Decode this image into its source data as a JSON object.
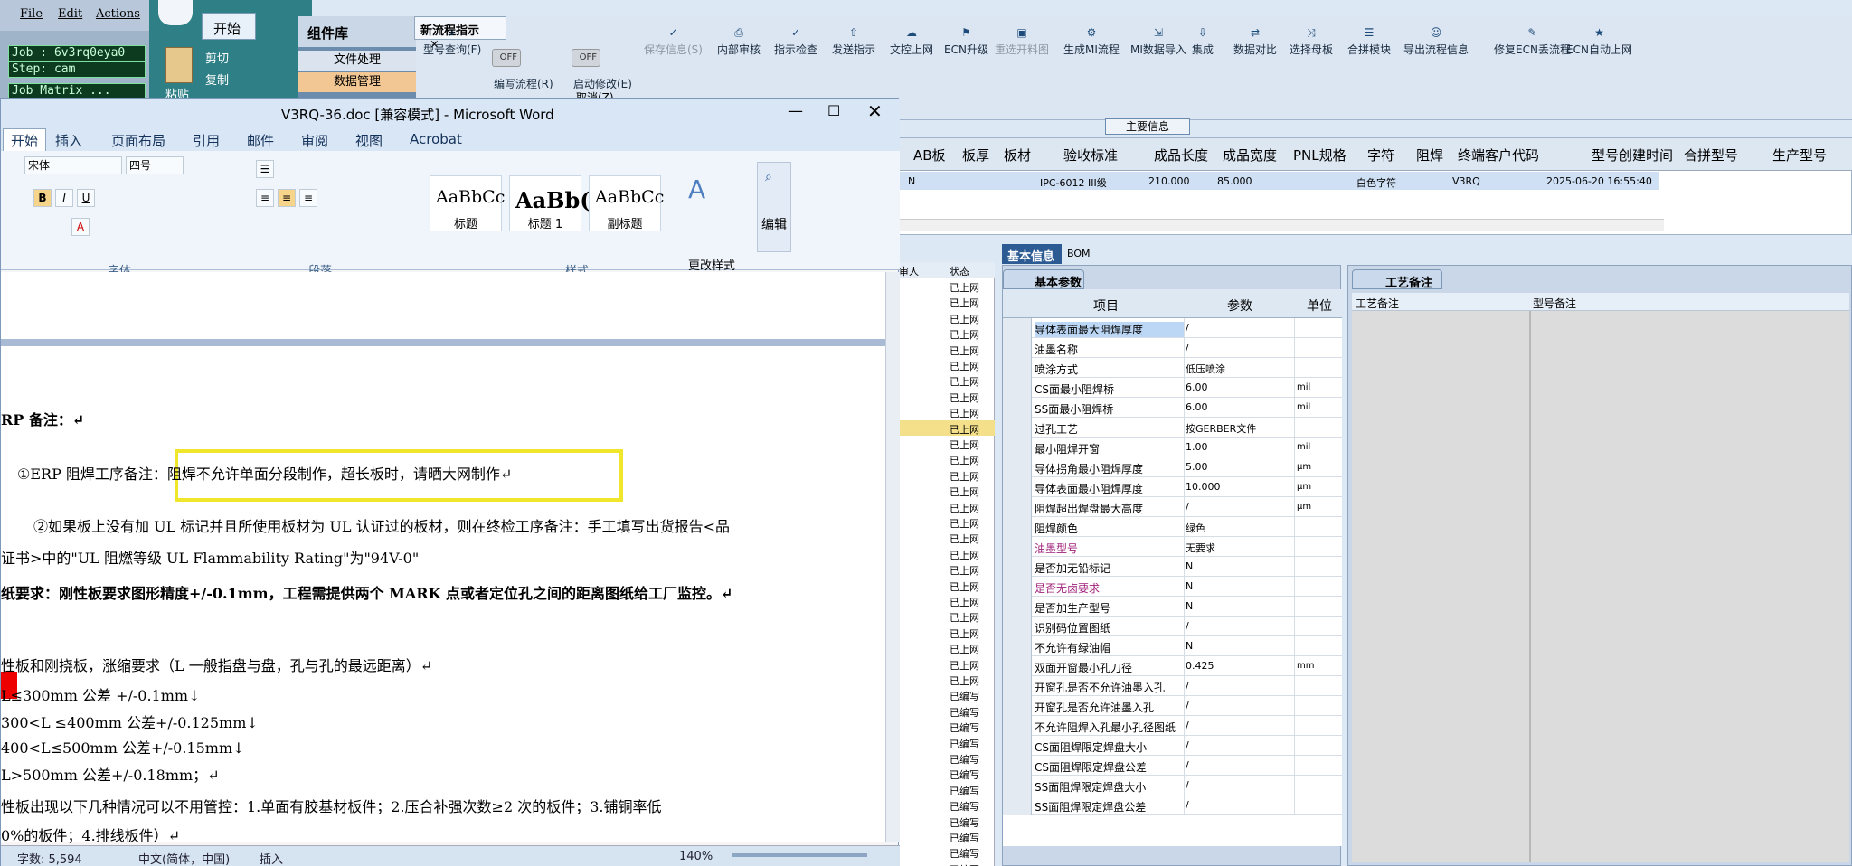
{
  "erp": {
    "menu": {
      "file": "File",
      "edit": "Edit",
      "actions": "Actions"
    },
    "job_label": "Job : 6v3rq0eya0",
    "step_label": "Step: cam",
    "matrix_label": "Job Matrix ...",
    "start_tab": "开始",
    "lib_header": "组件库",
    "lib_btn1": "文件处理",
    "lib_btn2": "数据管理",
    "doc_tab": "新流程指示",
    "cut_label": "剪切",
    "copy_label": "复制",
    "paste_label": "粘贴",
    "toolbar": [
      {
        "label": "型号查询(F)",
        "icon": "search-icon"
      },
      {
        "label": "编写流程(R)",
        "icon": "toggle"
      },
      {
        "label": "启动修改(E)",
        "icon": "toggle"
      },
      {
        "label": "保存信息(S)",
        "icon": "check-icon",
        "disabled": true
      },
      {
        "label": "内部审核",
        "icon": "print-icon"
      },
      {
        "label": "指示检查",
        "icon": "check-icon"
      },
      {
        "label": "发送指示",
        "icon": "upload-icon"
      },
      {
        "label": "文控上网",
        "icon": "cloud-icon"
      },
      {
        "label": "ECN升级",
        "icon": "ab-icon"
      },
      {
        "label": "重选开料图",
        "icon": "image-icon",
        "disabled": true
      },
      {
        "label": "生成MI流程",
        "icon": "gear-icon"
      },
      {
        "label": "MI数据导入",
        "icon": "import-icon"
      },
      {
        "label": "集成",
        "icon": "download-icon"
      },
      {
        "label": "数据对比",
        "icon": "compare-icon"
      },
      {
        "label": "选择母板",
        "icon": "shuffle-icon"
      },
      {
        "label": "合拼模块",
        "icon": "list-icon"
      },
      {
        "label": "导出流程信息",
        "icon": "smile-icon"
      },
      {
        "label": "修复ECN丢流程",
        "icon": "wrench-icon"
      },
      {
        "label": "ECN自动上网",
        "icon": "star-icon"
      }
    ],
    "toggle_off": "OFF",
    "cancel_label": "取消(Z)",
    "main_info": "主要信息",
    "top_headers": [
      "AB板",
      "板厚",
      "板材",
      "验收标准",
      "成品长度",
      "成品宽度",
      "PNL规格",
      "字符",
      "阻焊",
      "终端客户代码",
      "型号创建时间",
      "合拼型号",
      "生产型号"
    ],
    "top_row": {
      "c0": "N",
      "std": "IPC-6012 III级",
      "len": "210.000",
      "wid": "85.000",
      "char": "白色字符",
      "code": "V3RQ",
      "time": "2025-06-20 16:55:40"
    },
    "tab_basic": "基本信息",
    "tab_bom": "BOM",
    "params_title": "基本参数",
    "params_headers": {
      "item": "项目",
      "param": "参数",
      "unit": "单位"
    },
    "params": [
      {
        "item": "导体表面最大阻焊厚度",
        "param": "/",
        "unit": ""
      },
      {
        "item": "油墨名称",
        "param": "/",
        "unit": ""
      },
      {
        "item": "喷涂方式",
        "param": "低压喷涂",
        "unit": ""
      },
      {
        "item": "CS面最小阻焊桥",
        "param": "6.00",
        "unit": "mil"
      },
      {
        "item": "SS面最小阻焊桥",
        "param": "6.00",
        "unit": "mil"
      },
      {
        "item": "过孔工艺",
        "param": "按GERBER文件",
        "unit": ""
      },
      {
        "item": "最小阻焊开窗",
        "param": "1.00",
        "unit": "mil"
      },
      {
        "item": "导体拐角最小阻焊厚度",
        "param": "5.00",
        "unit": "μm"
      },
      {
        "item": "导体表面最小阻焊厚度",
        "param": "10.000",
        "unit": "μm"
      },
      {
        "item": "阻焊超出焊盘最大高度",
        "param": "/",
        "unit": "μm"
      },
      {
        "item": "阻焊颜色",
        "param": "绿色",
        "unit": ""
      },
      {
        "item": "油墨型号",
        "param": "无要求",
        "unit": ""
      },
      {
        "item": "是否加无铅标记",
        "param": "N",
        "unit": ""
      },
      {
        "item": "是否无卤要求",
        "param": "N",
        "unit": ""
      },
      {
        "item": "是否加生产型号",
        "param": "N",
        "unit": ""
      },
      {
        "item": "识别码位置图纸",
        "param": "/",
        "unit": ""
      },
      {
        "item": "不允许有绿油帽",
        "param": "N",
        "unit": ""
      },
      {
        "item": "双面开窗最小孔刀径",
        "param": "0.425",
        "unit": "mm"
      },
      {
        "item": "开窗孔是否不允许油墨入孔",
        "param": "/",
        "unit": ""
      },
      {
        "item": "开窗孔是否允许油墨入孔",
        "param": "/",
        "unit": ""
      },
      {
        "item": "不允许阻焊入孔最小孔径图纸",
        "param": "/",
        "unit": ""
      },
      {
        "item": "CS面阻焊限定焊盘大小",
        "param": "/",
        "unit": ""
      },
      {
        "item": "CS面阻焊限定焊盘公差",
        "param": "/",
        "unit": ""
      },
      {
        "item": "SS面阻焊限定焊盘大小",
        "param": "/",
        "unit": ""
      },
      {
        "item": "SS面阻焊限定焊盘公差",
        "param": "/",
        "unit": ""
      }
    ],
    "notes_title": "工艺备注",
    "notes_headers": {
      "process": "工艺备注",
      "model": "型号备注"
    },
    "status_header_a": "审人",
    "status_header_b": "状态",
    "status_up": "已上网",
    "status_edit": "已编写"
  },
  "word": {
    "title": "V3RQ-36.doc [兼容模式] - Microsoft Word",
    "tabs": [
      "开始",
      "插入",
      "页面布局",
      "引用",
      "邮件",
      "审阅",
      "视图",
      "Acrobat"
    ],
    "font_name": "宋体",
    "font_size": "四号",
    "styles": [
      {
        "sample": "AaBbCc",
        "name": "标题"
      },
      {
        "sample": "AaBb(",
        "name": "标题 1"
      },
      {
        "sample": "AaBbCc",
        "name": "副标题"
      }
    ],
    "change_style": "更改样式",
    "edit": "编辑",
    "groups": {
      "font": "字体",
      "para": "段落",
      "style": "样式"
    },
    "lines": [
      "RP 备注：↵",
      "①ERP 阻焊工序备注：阻焊不允许单面分段制作，超长板时，请晒大网制作↵",
      "②如果板上没有加 UL 标记并且所使用板材为 UL 认证过的板材，则在终检工序备注：手工填写出货报告<品",
      "证书>中的\"UL 阻燃等级 UL Flammability Rating\"为\"94V-0\"",
      "纸要求：刚性板要求图形精度+/-0.1mm，工程需提供两个 MARK 点或者定位孔之间的距离图纸给工厂监控。↵",
      "性板和刚挠板，涨缩要求（L 一般指盘与盘，孔与孔的最远距离）↵",
      "L≤300mm 公差 +/-0.1mm↓",
      "300<L ≤400mm 公差+/-0.125mm↓",
      "400<L≤500mm 公差+/-0.15mm↓",
      "L>500mm 公差+/-0.18mm；↵",
      "性板出现以下几种情况可以不用管控：1.单面有胶基材板件；2.压合补强次数≥2 次的板件；3.铺铜率低",
      "0%的板件；4.排线板件）↵"
    ],
    "status": {
      "words": "字数: 5,594",
      "lang": "中文(简体，中国)",
      "mode": "插入",
      "zoom": "140%"
    }
  }
}
